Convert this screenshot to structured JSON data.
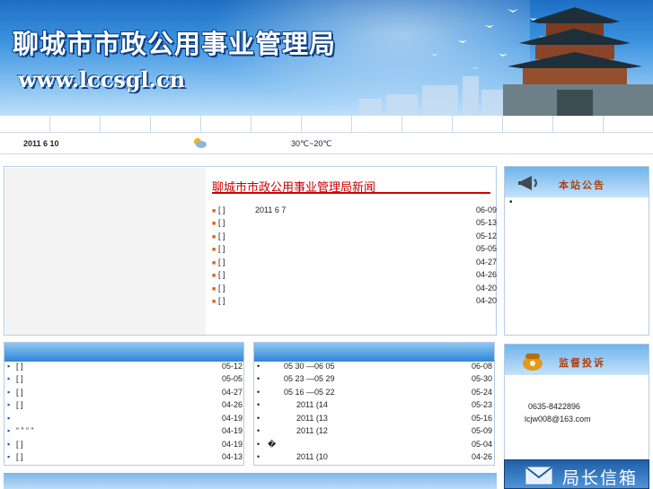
{
  "header": {
    "site_title": "聊城市市政公用事业管理局",
    "site_url": "www.lccsgl.cn"
  },
  "datebar": {
    "date": "2011  6  10",
    "weather_icon": "partly-cloudy-icon",
    "temperature": "30℃~20℃"
  },
  "news": {
    "headline": "聊城市市政公用事业管理局新闻",
    "items": [
      {
        "bracket": "[  ]",
        "text": "2011 6 7",
        "date": "06-09"
      },
      {
        "bracket": "[  ]",
        "text": "",
        "date": "05-13"
      },
      {
        "bracket": "[  ]",
        "text": "",
        "date": "05-12"
      },
      {
        "bracket": "[  ]",
        "text": "",
        "date": "05-05"
      },
      {
        "bracket": "[  ]",
        "text": "",
        "date": "04-27"
      },
      {
        "bracket": "[  ]",
        "text": "",
        "date": "04-26"
      },
      {
        "bracket": "[  ]",
        "text": "",
        "date": "04-20"
      },
      {
        "bracket": "[  ]",
        "text": "",
        "date": "04-20"
      }
    ]
  },
  "left_list": {
    "items": [
      {
        "text": "[ ]",
        "date": "05-12"
      },
      {
        "text": "[ ]",
        "date": "05-05"
      },
      {
        "text": "[ ]",
        "date": "04-27"
      },
      {
        "text": "[ ]",
        "date": "04-26"
      },
      {
        "text": "",
        "date": "04-19"
      },
      {
        "text": "  “ ” “ ”",
        "date": "04-19"
      },
      {
        "text": "[ ]",
        "date": "04-19"
      },
      {
        "text": "[ ]",
        "date": "04-13"
      }
    ]
  },
  "mid_list": {
    "items": [
      {
        "text": "05 30 —06 05",
        "date": "06-08"
      },
      {
        "text": "05 23 —05 29",
        "date": "05-30"
      },
      {
        "text": "05 16 —05 22",
        "date": "05-24"
      },
      {
        "text": "2011  (14",
        "date": "05-23"
      },
      {
        "text": "2011  (13",
        "date": "05-16"
      },
      {
        "text": "2011  (12",
        "date": "05-09"
      },
      {
        "text": "�",
        "date": "05-04"
      },
      {
        "text": "2011  (10",
        "date": "04-26"
      }
    ]
  },
  "notice": {
    "label": "本站公告",
    "bullet": "•"
  },
  "complaint": {
    "label": "监督投诉",
    "phone": "0635-8422896",
    "email": "lcjw008@163.com"
  },
  "mayor_mailbox": {
    "label": "局长信箱"
  }
}
